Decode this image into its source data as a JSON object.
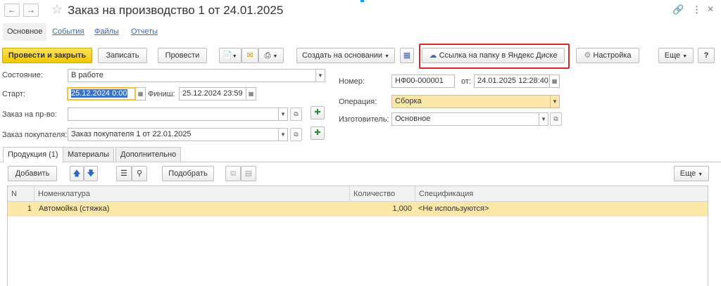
{
  "window": {
    "title": "Заказ на производство 1 от 24.01.2025",
    "back_icon": "arrow-left-icon",
    "forward_icon": "arrow-right-icon"
  },
  "tabs": [
    {
      "label": "Основное",
      "active": true
    },
    {
      "label": "События"
    },
    {
      "label": "Файлы"
    },
    {
      "label": "Отчеты"
    }
  ],
  "toolbar": {
    "post_close": "Провести и закрыть",
    "save": "Записать",
    "post": "Провести",
    "create_based": "Создать на основании",
    "yandex_link": "Ссылка на папку в Яндекс Диске",
    "settings": "Настройка",
    "more": "Еще",
    "help": "?"
  },
  "form": {
    "state_label": "Состояние:",
    "state_value": "В работе",
    "start_label": "Старт:",
    "start_value": "25.12.2024  0:00",
    "finish_label": "Финиш:",
    "finish_value": "25.12.2024 23:59",
    "order_label": "Заказ на пр-во:",
    "order_value": "",
    "customer_order_label": "Заказ покупателя:",
    "customer_order_value": "Заказ покупателя 1 от 22.01.2025",
    "number_label": "Номер:",
    "number_value": "НФ00-000001",
    "date_label": "от:",
    "date_value": "24.01.2025 12:28:40",
    "operation_label": "Операция:",
    "operation_value": "Сборка",
    "maker_label": "Изготовитель:",
    "maker_value": "Основное"
  },
  "page_tabs": [
    {
      "label": "Продукция (1)",
      "active": true
    },
    {
      "label": "Материалы"
    },
    {
      "label": "Дополнительно"
    }
  ],
  "table_toolbar": {
    "add": "Добавить",
    "pick": "Подобрать",
    "more": "Еще"
  },
  "table": {
    "columns": [
      "N",
      "Номенклатура",
      "Количество",
      "Спецификация"
    ],
    "rows": [
      {
        "n": "1",
        "item": "Автомойка (стяжка)",
        "qty": "1,000",
        "spec": "<Не используются>"
      }
    ]
  },
  "colors": {
    "primary_button": "#f2c800",
    "highlight": "#d9262a",
    "selected_row": "#fbe7a8",
    "link": "#3a6aa8"
  }
}
